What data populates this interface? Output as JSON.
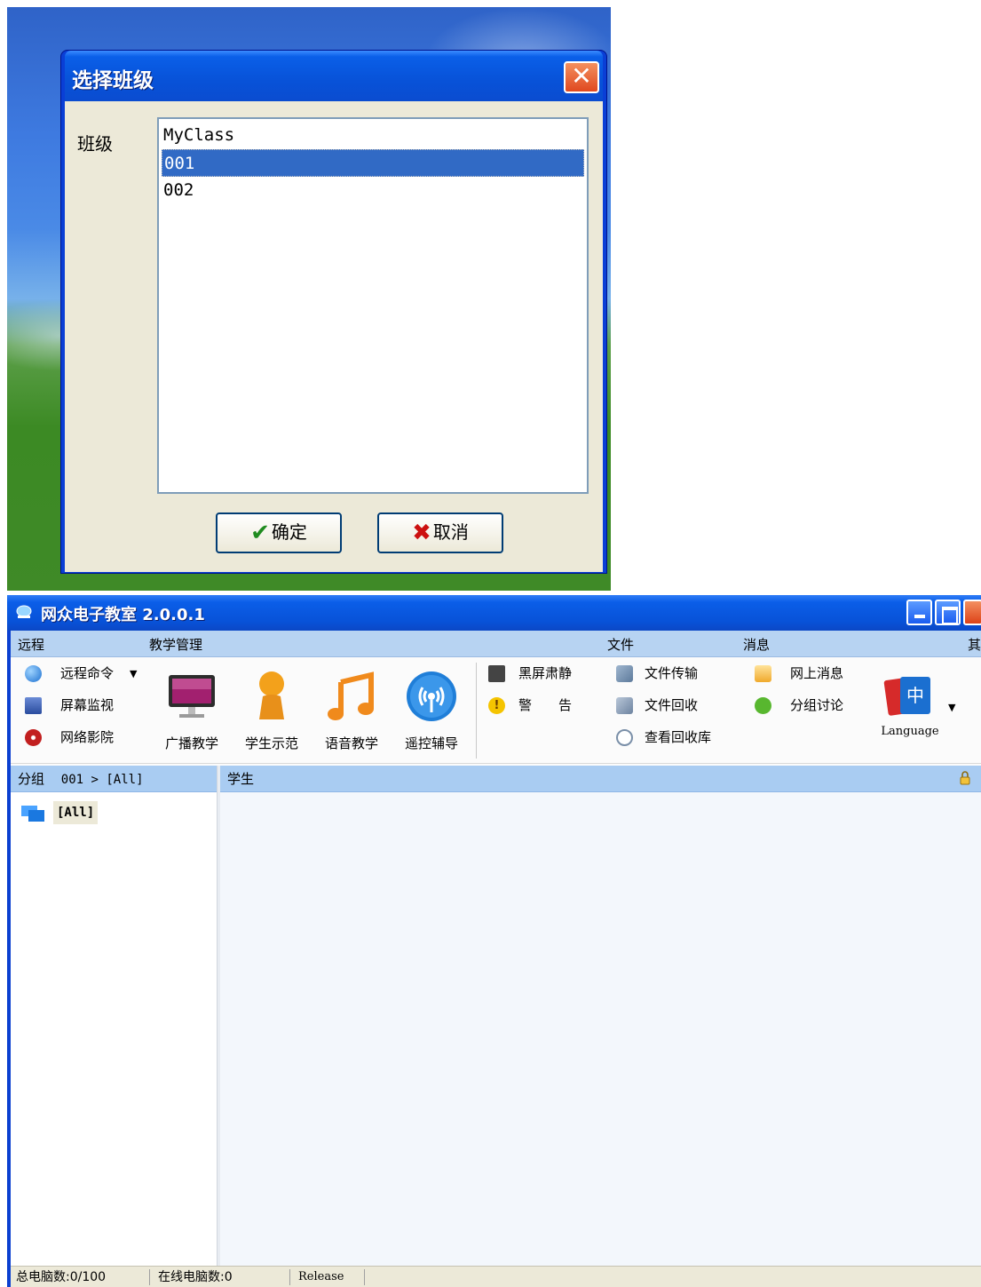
{
  "dialog": {
    "title": "选择班级",
    "class_label": "班级",
    "list_items": [
      "MyClass",
      "001",
      "002"
    ],
    "selected_item": "001",
    "ok_label": "确定",
    "cancel_label": "取消"
  },
  "app": {
    "title": "网众电子教室 2.0.0.1",
    "ribbon_tabs": [
      "远程",
      "教学管理",
      "文件",
      "消息",
      "其"
    ],
    "remote": {
      "items": [
        "远程命令",
        "屏幕监视",
        "网络影院"
      ]
    },
    "teaching": {
      "buttons": [
        "广播教学",
        "学生示范",
        "语音教学",
        "遥控辅导"
      ],
      "small": [
        "黑屏肃静",
        "警　　告"
      ]
    },
    "file": {
      "items": [
        "文件传输",
        "文件回收",
        "查看回收库"
      ]
    },
    "message": {
      "items": [
        "网上消息",
        "分组讨论"
      ]
    },
    "language_label": "Language",
    "language_icon_text": "中",
    "left_header": "分组",
    "breadcrumb": "001 > [All]",
    "right_header": "学生",
    "tree_item": "[All]",
    "status": {
      "total": "总电脑数:0/100",
      "online": "在线电脑数:0",
      "release": "Release"
    }
  }
}
